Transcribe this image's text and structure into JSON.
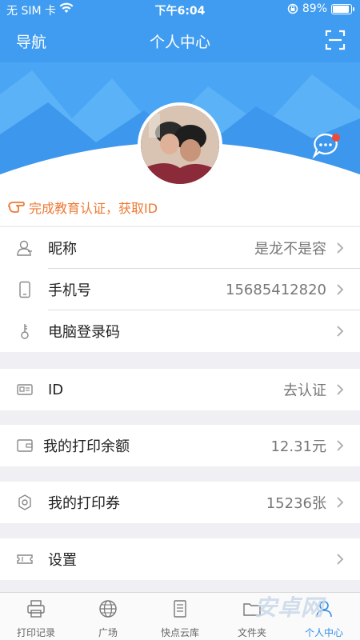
{
  "status": {
    "carrier": "无 SIM 卡",
    "time": "下午6:04",
    "battery_text": "89%",
    "battery_level": 0.89
  },
  "nav": {
    "left_label": "导航",
    "title": "个人中心"
  },
  "edu_banner": {
    "text": "完成教育认证，获取ID"
  },
  "rows": {
    "nickname": {
      "label": "昵称",
      "value": "是龙不是容"
    },
    "phone": {
      "label": "手机号",
      "value": "15685412820"
    },
    "pc_code": {
      "label": "电脑登录码",
      "value": ""
    },
    "id": {
      "label": "ID",
      "value": "去认证"
    },
    "balance": {
      "label": "我的打印余额",
      "value": "12.31元"
    },
    "coupons": {
      "label": "我的打印券",
      "value": "15236张"
    },
    "settings": {
      "label": "设置",
      "value": ""
    }
  },
  "tabs": [
    {
      "label": "打印记录",
      "icon": "printer-icon"
    },
    {
      "label": "广场",
      "icon": "globe-icon"
    },
    {
      "label": "快点云库",
      "icon": "library-icon"
    },
    {
      "label": "文件夹",
      "icon": "folder-icon"
    },
    {
      "label": "个人中心",
      "icon": "person-icon"
    }
  ],
  "watermark": "安卓网",
  "colors": {
    "primary": "#3f9cf0",
    "accent_orange": "#ed7a35",
    "active_tab": "#2f8ee8"
  }
}
